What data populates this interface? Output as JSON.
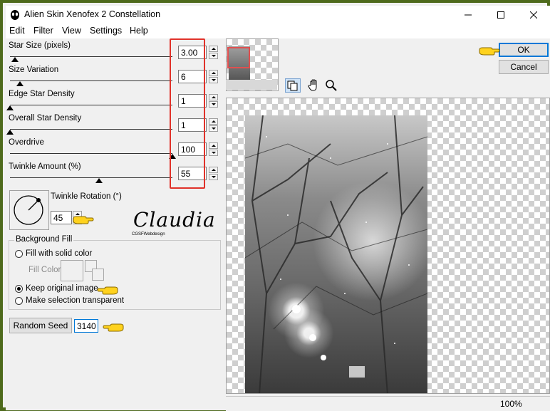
{
  "window": {
    "title": "Alien Skin Xenofex 2 Constellation"
  },
  "menu": [
    "Edit",
    "Filter",
    "View",
    "Settings",
    "Help"
  ],
  "params": [
    {
      "label": "Star Size (pixels)",
      "value": "3.00",
      "slider_fraction": 0.03
    },
    {
      "label": "Size Variation",
      "value": "6",
      "slider_fraction": 0.06
    },
    {
      "label": "Edge Star Density",
      "value": "1",
      "slider_fraction": 0.0
    },
    {
      "label": "Overall Star Density",
      "value": "1",
      "slider_fraction": 0.0
    },
    {
      "label": "Overdrive",
      "value": "100",
      "slider_fraction": 1.0
    },
    {
      "label": "Twinkle Amount (%)",
      "value": "55",
      "slider_fraction": 0.55
    }
  ],
  "rotation": {
    "label": "Twinkle Rotation (°)",
    "value": "45"
  },
  "signature": {
    "name": "Claudia",
    "sub": "CGSFWebdesign"
  },
  "background_fill": {
    "title": "Background Fill",
    "fill_solid_label": "Fill with solid color",
    "fill_color_label": "Fill Color",
    "keep_original_label": "Keep original image",
    "make_transparent_label": "Make selection transparent",
    "selected": "keep_original"
  },
  "random_seed": {
    "button_label": "Random Seed",
    "value": "3140"
  },
  "buttons": {
    "ok": "OK",
    "cancel": "Cancel"
  },
  "status": {
    "zoom": "100%"
  },
  "colors": {
    "frame": "#4e6a1c",
    "highlight_box": "#e0322a",
    "ok_border": "#0078d7"
  }
}
